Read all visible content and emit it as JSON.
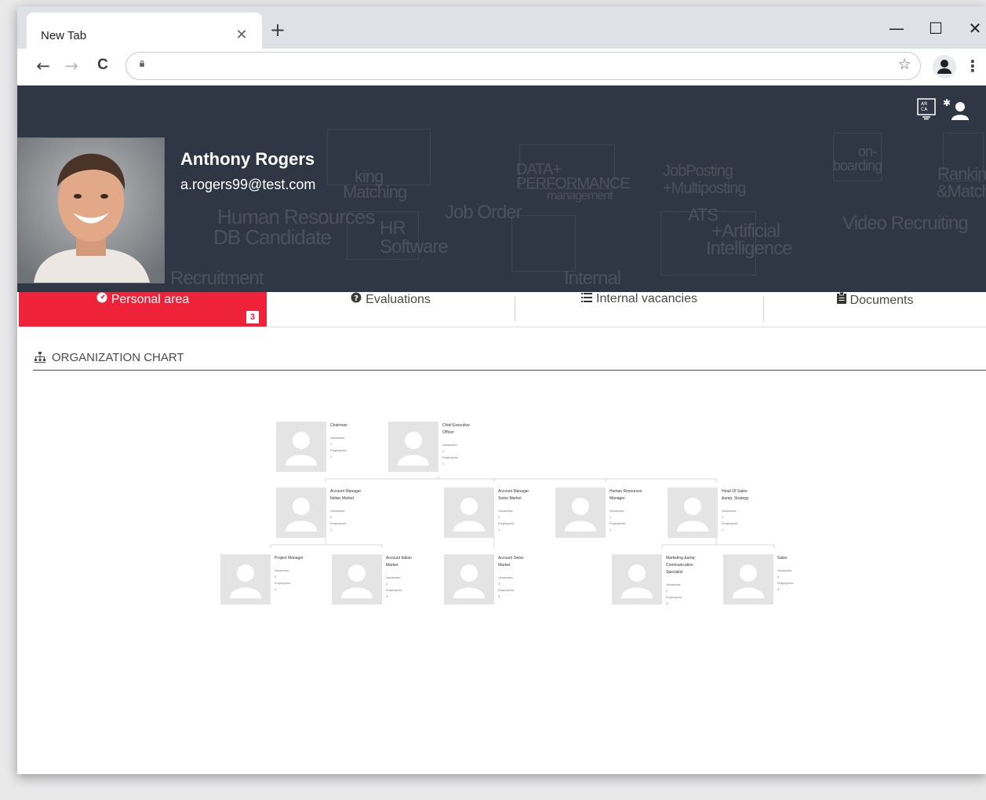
{
  "browser": {
    "tab_title": "New Tab",
    "tab_close_icon": "close-icon",
    "new_tab_symbol": "+",
    "controls": {
      "minimize": "—",
      "maximize": "☐",
      "close": "✕"
    },
    "nav": {
      "back": "←",
      "forward": "→",
      "reload": "C"
    },
    "address": "",
    "star": "☆",
    "menu": "⋮"
  },
  "header": {
    "user_name": "Anthony Rogers",
    "user_email": "a.rogers99@test.com",
    "icons": [
      "language-icon",
      "user-settings-icon"
    ],
    "background_words": [
      "king",
      "Matching",
      "DATA+",
      "PERFORMANCE",
      "management",
      "JobPosting",
      "+Multiposting",
      "on-",
      "boarding",
      "Ranking",
      "&Match",
      "Human Resources",
      "DB Candidate",
      "HR",
      "Software",
      "Job Order",
      "ATS",
      "+Artificial",
      "Intelligence",
      "Video Recruiting",
      "Recruitment",
      "Internal"
    ]
  },
  "tabs": [
    {
      "label": "Personal area",
      "icon": "dashboard-icon",
      "badge": "3",
      "active": true
    },
    {
      "label": "Evaluations",
      "icon": "question-circle-icon",
      "active": false
    },
    {
      "label": "Internal vacancies",
      "icon": "list-icon",
      "active": false
    },
    {
      "label": "Documents",
      "icon": "clipboard-icon",
      "active": false
    }
  ],
  "section": {
    "title": "ORGANIZATION CHART",
    "icon": "sitemap-icon"
  },
  "colors": {
    "accent": "#ee2239",
    "banner": "#303744",
    "placeholder": "#e4e4e4"
  },
  "org": {
    "vacancies_label": "Vacancies:",
    "employees_label": "Employees:",
    "nodes": [
      {
        "id": "chairman",
        "title": [
          "Chairman"
        ],
        "vacancies": "1",
        "employees": "1"
      },
      {
        "id": "ceo",
        "title": [
          "Chief Executive",
          "Officer"
        ],
        "vacancies": "1",
        "employees": "1"
      },
      {
        "id": "am_italian",
        "title": [
          "Account Manager",
          "Italian Market"
        ],
        "vacancies": "2",
        "employees": "1"
      },
      {
        "id": "am_swiss",
        "title": [
          "Account Manager",
          "Swiss Market"
        ],
        "vacancies": "2",
        "employees": "1"
      },
      {
        "id": "hr_manager",
        "title": [
          "Human Resources",
          "Manager"
        ],
        "vacancies": "1",
        "employees": "1"
      },
      {
        "id": "head_sales",
        "title": [
          "Head Of Sales",
          "&amp; Strategy"
        ],
        "vacancies": "1",
        "employees": "1"
      },
      {
        "id": "project_manager",
        "title": [
          "Project Manager"
        ],
        "vacancies": "2",
        "employees": "1"
      },
      {
        "id": "acc_italian",
        "title": [
          "Account Italian",
          "Market"
        ],
        "vacancies": "4",
        "employees": "3"
      },
      {
        "id": "acc_swiss",
        "title": [
          "Account Swiss",
          "Market"
        ],
        "vacancies": "3",
        "employees": "3"
      },
      {
        "id": "marketing",
        "title": [
          "Marketing &amp;",
          "Communication",
          "Specialist"
        ],
        "vacancies": "2",
        "employees": "3"
      },
      {
        "id": "sales",
        "title": [
          "Sales"
        ],
        "vacancies": "4",
        "employees": "3"
      }
    ]
  }
}
